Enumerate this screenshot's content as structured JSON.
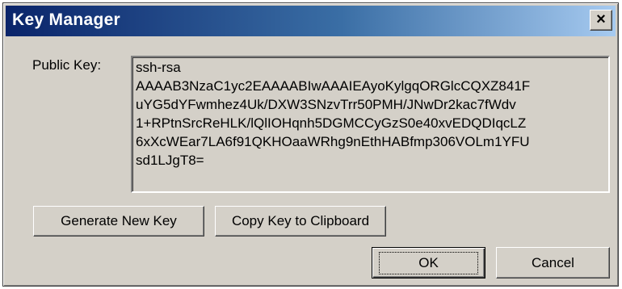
{
  "window": {
    "title": "Key Manager",
    "close_glyph": "×"
  },
  "public_key": {
    "label": "Public Key:",
    "value": "ssh-rsa\nAAAAB3NzaC1yc2EAAAABIwAAAIEAyoKylgqORGlcCQXZ841F\nuYG5dYFwmhez4Uk/DXW3SNzvTrr50PMH/JNwDr2kac7fWdv\n1+RPtnSrcReHLK/lQlIOHqnh5DGMCCyGzS0e40xvEDQDIqcLZ\n6xXcWEar7LA6f91QKHOaaWRhg9nEthHABfmp306VOLm1YFU\nsd1LJgT8="
  },
  "buttons": {
    "generate": "Generate New Key",
    "copy": "Copy Key to Clipboard",
    "ok": "OK",
    "cancel": "Cancel"
  }
}
